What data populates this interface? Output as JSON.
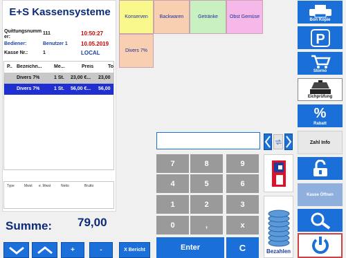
{
  "app": {
    "title": "E+S Kassensysteme"
  },
  "info": {
    "quittung_label": "Quittungsnumm er:",
    "quittung_value": "111",
    "time1": "10:50:27",
    "bediener_label": "Bediener:",
    "bediener_value": "Benutzer 1",
    "date": "10.05.2019",
    "kasse_label": "Kasse Nr.:",
    "kasse_value": "1",
    "mode": "LOCAL"
  },
  "cart": {
    "columns": [
      "P..",
      "Bezeichn...",
      "Me...",
      "Preis",
      "To"
    ],
    "rows": [
      {
        "name": "Divers 7%",
        "qty": "1 St.",
        "price": "23,00 €...",
        "total": "23,00"
      },
      {
        "name": "Divers 7%",
        "qty": "1 St.",
        "price": "56,00 €...",
        "total": "56,00"
      }
    ]
  },
  "tax": {
    "columns": [
      "Type",
      "Mwst",
      "e. Mwst",
      "Netto",
      "Brutto"
    ]
  },
  "summe": {
    "label": "Summe:",
    "value": "79,00"
  },
  "bottom": {
    "plus": "+",
    "minus": "-",
    "xbericht": "X Bericht"
  },
  "categories": [
    "Konserven",
    "Backwaren",
    "Getränke",
    "Obst Gemüse",
    "Divers 7%"
  ],
  "numpad": {
    "keys": [
      "7",
      "8",
      "9",
      "4",
      "5",
      "6",
      "1",
      "2",
      "3",
      "0",
      ",",
      "x"
    ],
    "enter": "Enter",
    "clear": "C",
    "bezahlen": "Bezahlen"
  },
  "right": {
    "bon_kopie": "Bon Kopie",
    "storno": "Storno",
    "eichpruefung": "Eichprüfung",
    "rabatt": "Rabatt",
    "zahl_info": "Zahl Info",
    "kasse_oeffnen": "Kasse Öffnen"
  },
  "colors": {
    "accent": "#1a6fd8",
    "title": "#0b2a78",
    "numpad": "#9a9a9a",
    "selected_row": "#1f2fd0"
  }
}
